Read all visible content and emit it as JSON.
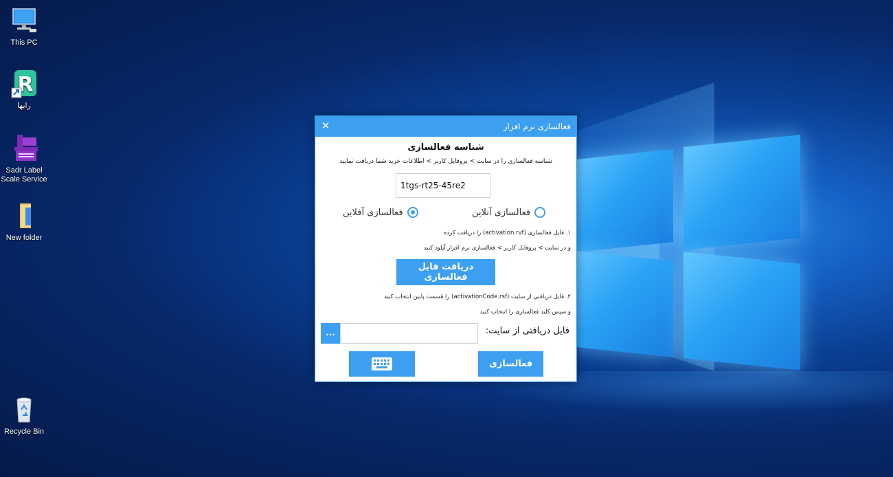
{
  "desktop": {
    "icons": [
      {
        "label": "This PC",
        "icon": "computer-icon"
      },
      {
        "label": "رایها",
        "icon": "rayha-app-icon"
      },
      {
        "label": "Sadr Label Scale Service",
        "icon": "scale-service-icon"
      },
      {
        "label": "New folder",
        "icon": "folder-icon"
      },
      {
        "label": "Recycle Bin",
        "icon": "recycle-bin-icon"
      }
    ]
  },
  "dialog": {
    "title": "فعالسازی نرم افزار",
    "close_glyph": "✕",
    "heading": "شناسه فعالسازی",
    "subtext": "شناسه فعالسازی را در سایت > پروفایل کاربر > اطلاعات خرید شما دریافت نمایید",
    "activation_code": "1tgs-rt25-45re2",
    "radio_online": "فعالسازی آنلاین",
    "radio_offline": "فعالسازی آفلاین",
    "selected_mode": "offline",
    "step1_line1": "۱. فایل فعالسازی (activation.rvf) را دریافت کرده",
    "step1_line2": "و در سایت > پروفایل کاربر > فعالسازی نرم افزار آپلود کنید",
    "download_button": "دریافت فایل فعالسازی",
    "step2_line1": "۲. فایل دریافتی از سایت (activationCode.rsf) را قسمت پایین انتخاب کنید",
    "step2_line2": "و سپس کلید فعالسازی را انتخاب کنید",
    "file_label": "فایل دریافتی از سایت:",
    "file_value": "",
    "browse_label": "...",
    "activate_button": "فعالسازی",
    "keyboard_icon": "keyboard-icon",
    "accent_color": "#3c9ff0"
  }
}
